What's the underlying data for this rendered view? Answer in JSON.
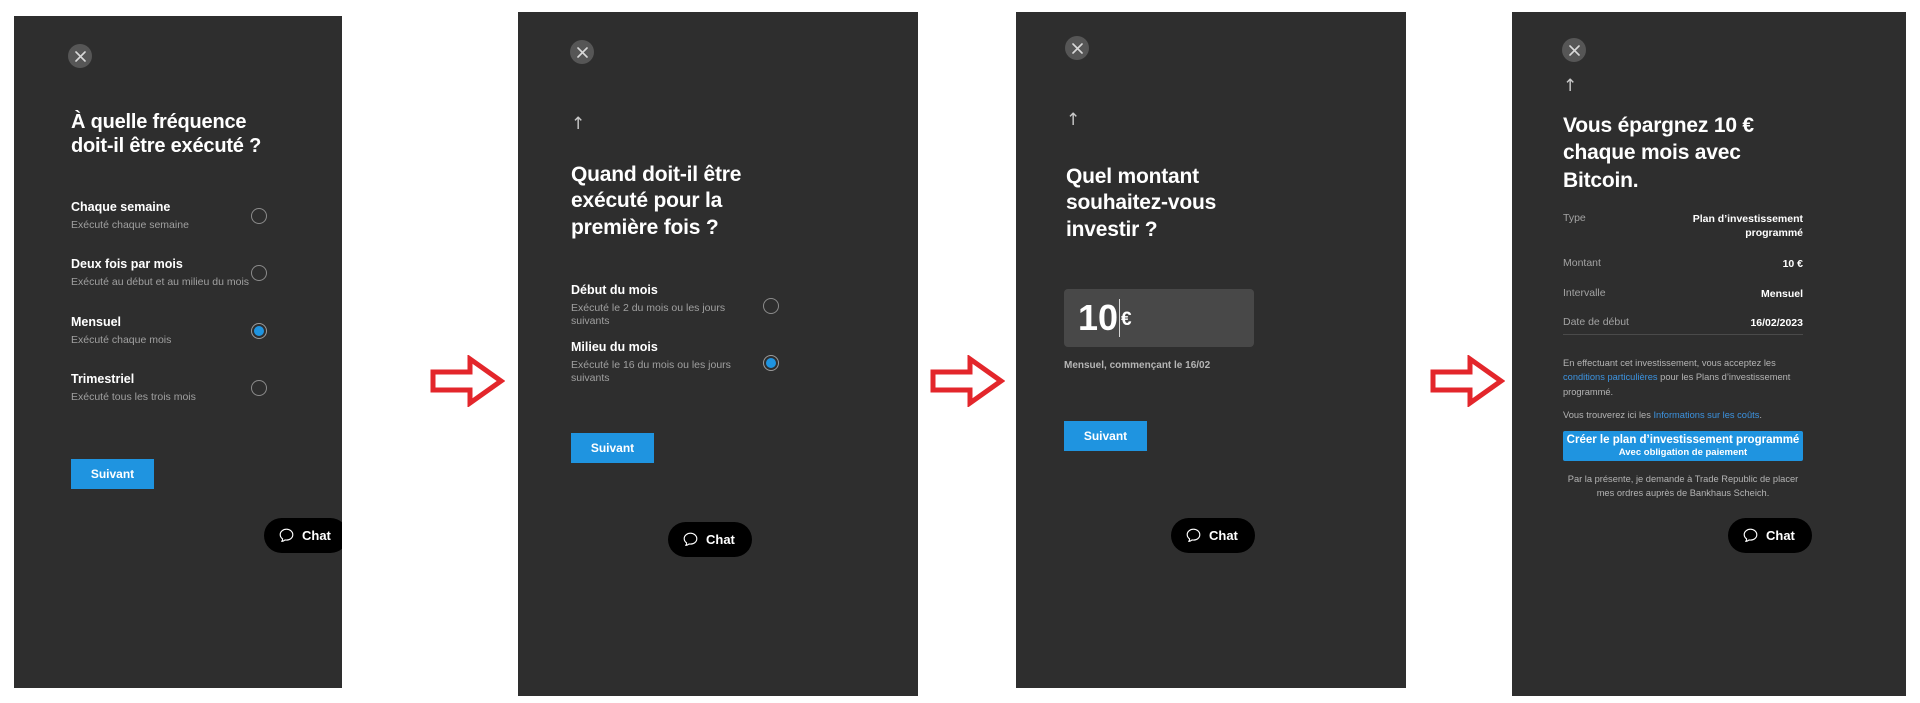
{
  "meta": {
    "brand_blue": "#1f94e0",
    "panel_bg": "#2e2e2e",
    "arrow_color": "#e3262b",
    "page_bg": "#ffffff"
  },
  "common": {
    "close_icon": "close-icon",
    "back_icon": "back-arrow-icon",
    "chat_icon": "chat-bubble-icon",
    "chat_label": "Chat",
    "next_label": "Suivant"
  },
  "panels": [
    {
      "id": "frequency",
      "headline": "À quelle fréquence doit-il être exécuté ?",
      "has_back": false,
      "options": [
        {
          "title": "Chaque semaine",
          "subtitle": "Exécuté chaque semaine",
          "selected": false
        },
        {
          "title": "Deux fois par mois",
          "subtitle": "Exécuté au début et au milieu du mois",
          "selected": false
        },
        {
          "title": "Mensuel",
          "subtitle": "Exécuté chaque mois",
          "selected": true
        },
        {
          "title": "Trimestriel",
          "subtitle": "Exécuté tous les trois mois",
          "selected": false
        }
      ],
      "next_label": "Suivant",
      "chat_label": "Chat"
    },
    {
      "id": "first-execution",
      "headline": "Quand doit-il être exécuté pour la première fois ?",
      "has_back": true,
      "options": [
        {
          "title": "Début du mois",
          "subtitle": "Exécuté le 2 du mois ou les jours suivants",
          "selected": false
        },
        {
          "title": "Milieu du mois",
          "subtitle": "Exécuté le 16 du mois ou les jours suivants",
          "selected": true
        }
      ],
      "next_label": "Suivant",
      "chat_label": "Chat"
    },
    {
      "id": "amount",
      "headline": "Quel montant souhaitez-vous investir ?",
      "has_back": true,
      "amount_value": "10",
      "amount_currency": "€",
      "amount_hint": "Mensuel, commençant le 16/02",
      "next_label": "Suivant",
      "chat_label": "Chat"
    },
    {
      "id": "summary",
      "headline": "Vous épargnez 10 € chaque mois avec Bitcoin.",
      "has_back": true,
      "summary_rows": [
        {
          "label": "Type",
          "value": "Plan d’investissement programmé"
        },
        {
          "label": "Montant",
          "value": "10 €"
        },
        {
          "label": "Intervalle",
          "value": "Mensuel"
        },
        {
          "label": "Date de début",
          "value": "16/02/2023"
        }
      ],
      "legal": {
        "line1_part1": "En effectuant cet investissement, vous acceptez les ",
        "line1_link": "conditions particulières",
        "line1_part2": " pour les Plans d’investissement programmé.",
        "line2_part1": "Vous trouverez ici les ",
        "line2_link": "Informations sur les coûts",
        "line2_part2": "."
      },
      "cta_title": "Créer le plan d’investissement programmé",
      "cta_subtitle": "Avec obligation de paiement",
      "disclaimer": "Par la présente, je demande à Trade Republic de placer mes ordres auprès de Bankhaus Scheich.",
      "chat_label": "Chat"
    }
  ],
  "arrows": [
    {
      "name": "flow-arrow-1"
    },
    {
      "name": "flow-arrow-2"
    },
    {
      "name": "flow-arrow-3"
    }
  ]
}
